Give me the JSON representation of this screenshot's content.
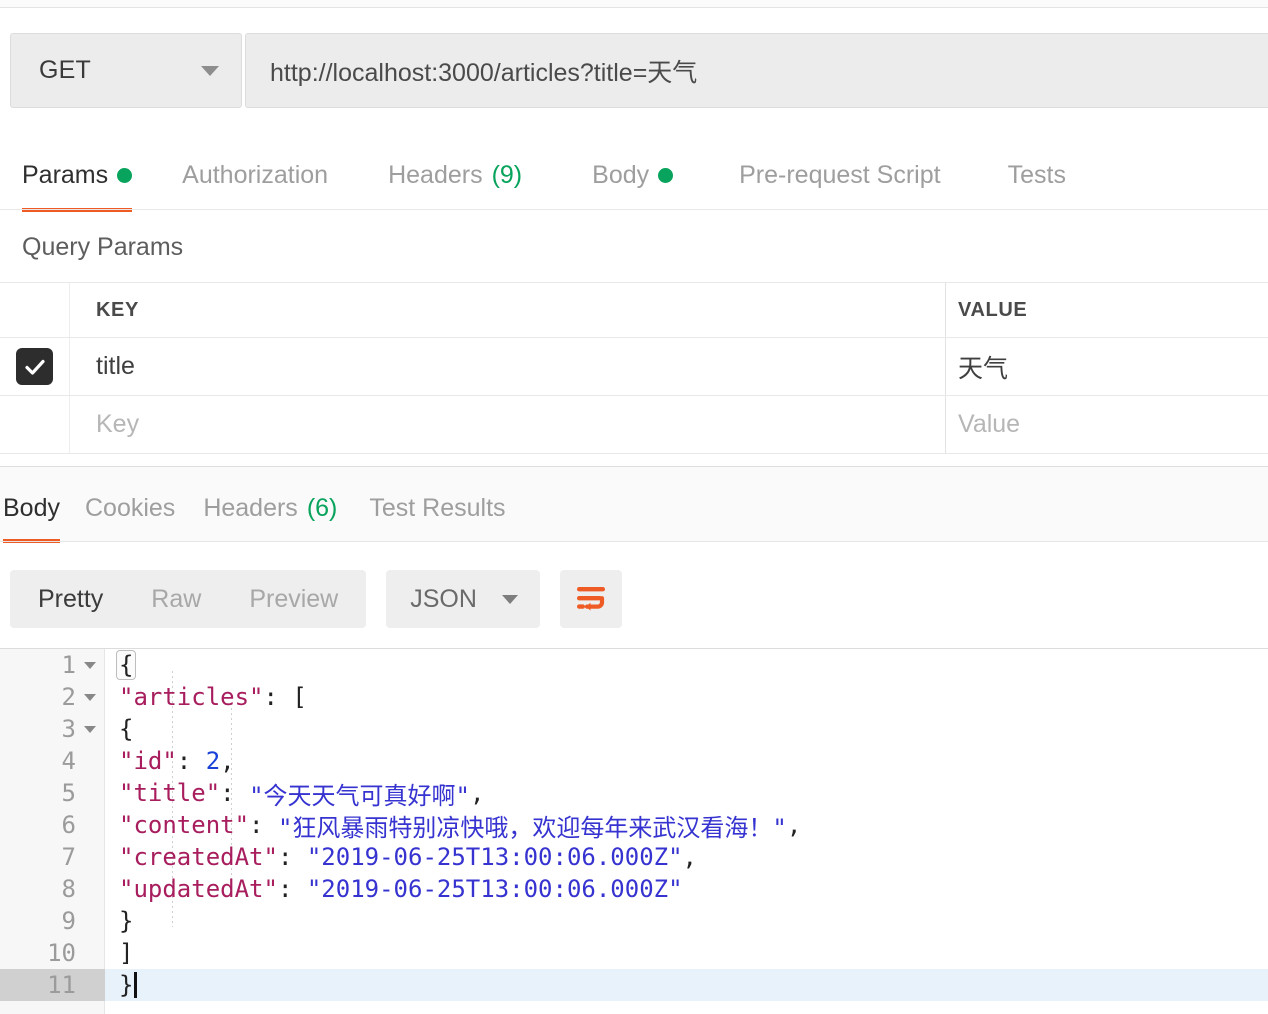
{
  "request": {
    "method": "GET",
    "url": "http://localhost:3000/articles?title=天气",
    "tabs": [
      {
        "label": "Params",
        "indicator": "dot",
        "active": true
      },
      {
        "label": "Authorization",
        "indicator": "none",
        "active": false
      },
      {
        "label": "Headers",
        "indicator": "count",
        "count": "(9)",
        "active": false
      },
      {
        "label": "Body",
        "indicator": "dot",
        "active": false
      },
      {
        "label": "Pre-request Script",
        "indicator": "none",
        "active": false
      },
      {
        "label": "Tests",
        "indicator": "none",
        "active": false
      }
    ]
  },
  "query_params": {
    "section_title": "Query Params",
    "columns": {
      "key": "KEY",
      "value": "VALUE"
    },
    "rows": [
      {
        "checked": true,
        "key": "title",
        "value": "天气"
      }
    ],
    "placeholder_row": {
      "key": "Key",
      "value": "Value"
    }
  },
  "response": {
    "tabs": [
      {
        "label": "Body",
        "indicator": "none",
        "active": true
      },
      {
        "label": "Cookies",
        "indicator": "none",
        "active": false
      },
      {
        "label": "Headers",
        "indicator": "count",
        "count": "(6)",
        "active": false
      },
      {
        "label": "Test Results",
        "indicator": "none",
        "active": false
      }
    ],
    "format_modes": [
      {
        "label": "Pretty",
        "active": true
      },
      {
        "label": "Raw",
        "active": false
      },
      {
        "label": "Preview",
        "active": false
      }
    ],
    "language_select": "JSON",
    "wrap_button_title": "Wrap Text",
    "body": {
      "lines": [
        {
          "n": "1",
          "foldable": true,
          "active": false,
          "text_plain": "{"
        },
        {
          "n": "2",
          "foldable": true,
          "active": false,
          "text_plain": "    \"articles\": ["
        },
        {
          "n": "3",
          "foldable": true,
          "active": false,
          "text_plain": "        {"
        },
        {
          "n": "4",
          "foldable": false,
          "active": false,
          "text_plain": "            \"id\": 2,"
        },
        {
          "n": "5",
          "foldable": false,
          "active": false,
          "text_plain": "            \"title\": \"今天天气可真好啊\","
        },
        {
          "n": "6",
          "foldable": false,
          "active": false,
          "text_plain": "            \"content\": \"狂风暴雨特别凉快哦，欢迎每年来武汉看海！\","
        },
        {
          "n": "7",
          "foldable": false,
          "active": false,
          "text_plain": "            \"createdAt\": \"2019-06-25T13:00:06.000Z\","
        },
        {
          "n": "8",
          "foldable": false,
          "active": false,
          "text_plain": "            \"updatedAt\": \"2019-06-25T13:00:06.000Z\""
        },
        {
          "n": "9",
          "foldable": false,
          "active": false,
          "text_plain": "        }"
        },
        {
          "n": "10",
          "foldable": false,
          "active": false,
          "text_plain": "    ]"
        },
        {
          "n": "11",
          "foldable": false,
          "active": true,
          "text_plain": "}"
        }
      ],
      "parsed_json": {
        "articles": [
          {
            "id": 2,
            "title": "今天天气可真好啊",
            "content": "狂风暴雨特别凉快哦，欢迎每年来武汉看海！",
            "createdAt": "2019-06-25T13:00:06.000Z",
            "updatedAt": "2019-06-25T13:00:06.000Z"
          }
        ]
      }
    }
  },
  "colors": {
    "accent_orange": "#ef5b25",
    "indicator_green": "#08a35c",
    "json_key": "#a71d5d",
    "json_string": "#3633d0",
    "json_number": "#1b42d8",
    "active_line_bg": "#e8f2fb"
  }
}
